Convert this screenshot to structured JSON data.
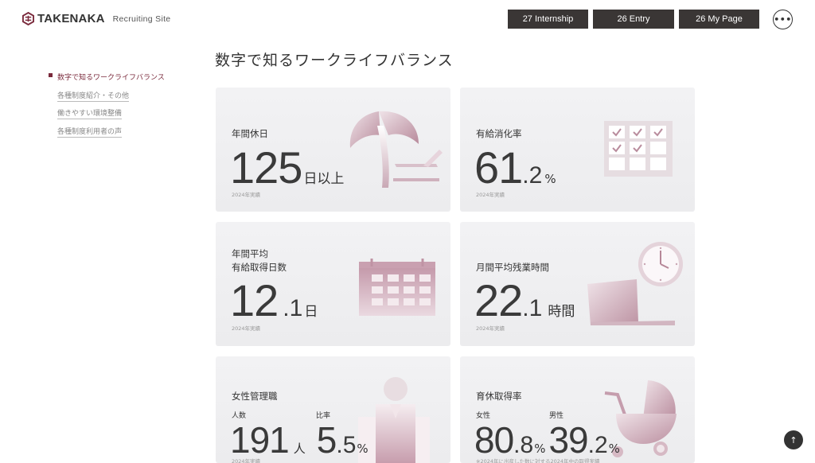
{
  "header": {
    "logo_text": "TAKENAKA",
    "logo_sub": "Recruiting Site",
    "nav": [
      "27 Internship",
      "26 Entry",
      "26 My Page"
    ],
    "menu_glyph": "•••",
    "brand_color": "#7a2a3c",
    "button_color": "#3a3635"
  },
  "page": {
    "title": "数字で知るワークライフバランス"
  },
  "side_nav": {
    "items": [
      {
        "label": "数字で知るワークライフバランス"
      },
      {
        "label": "各種制度紹介・その他"
      },
      {
        "label": "働きやすい環境整備"
      },
      {
        "label": "各種制度利用者の声"
      }
    ]
  },
  "cards": {
    "holidays": {
      "label": "年間休日",
      "value": "125",
      "unit": "日以上",
      "note": "2024年実績",
      "icon": "palm-tree-icon"
    },
    "paid_leave_rate": {
      "label": "有給消化率",
      "value": "61",
      "decimal": ".2",
      "unit": "%",
      "note": "2024年実績",
      "icon": "calendar-check-icon"
    },
    "paid_leave_days": {
      "label1": "年間平均",
      "label2": "有給取得日数",
      "value": "12",
      "decimal": ".1",
      "unit": "日",
      "note": "2024年実績",
      "icon": "calendar-icon"
    },
    "overtime": {
      "label": "月間平均残業時間",
      "value": "22",
      "decimal": ".1",
      "unit": "時間",
      "note": "2024年実績",
      "icon": "laptop-clock-icon"
    },
    "female_managers": {
      "label": "女性管理職",
      "sub1": "人数",
      "value1": "191",
      "unit1": "人",
      "sub2": "比率",
      "value2": "5",
      "decimal2": ".5",
      "unit2": "%",
      "note": "2024年実績",
      "icon": "people-icon"
    },
    "childcare_leave": {
      "label": "育休取得率",
      "sub1": "女性",
      "value1": "80",
      "decimal1": ".8",
      "unit1": "%",
      "sub2": "男性",
      "value2": "39",
      "decimal2": ".2",
      "unit2": "%",
      "note": "※2024年に出産した数に対する2024年中の取得実績",
      "icon": "stroller-icon"
    }
  },
  "back_to_top": "↑"
}
